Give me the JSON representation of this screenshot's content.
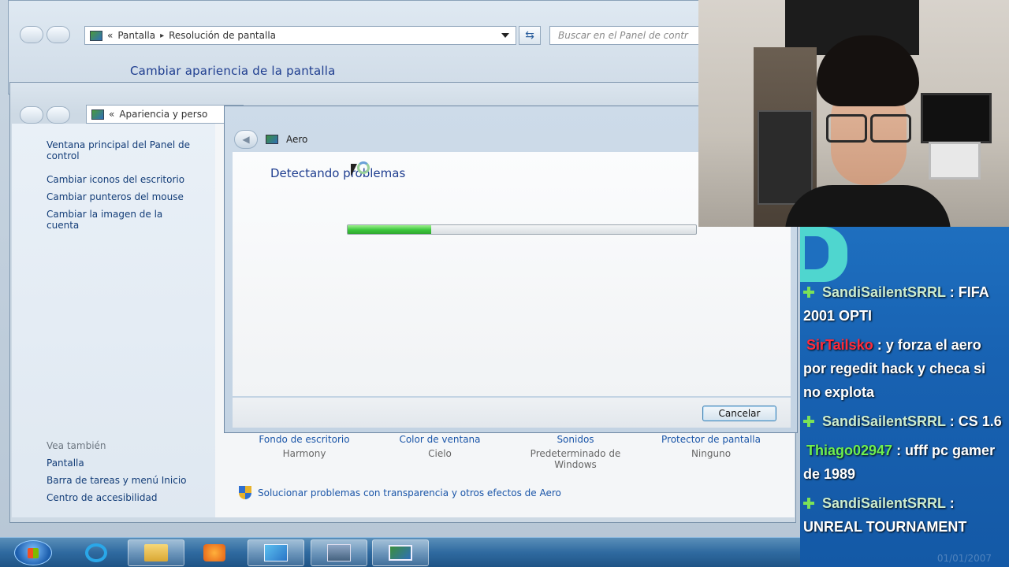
{
  "back_window": {
    "breadcrumb_sep": "«",
    "breadcrumb_1": "Pantalla",
    "breadcrumb_arrow": "▸",
    "breadcrumb_2": "Resolución de pantalla",
    "search_placeholder": "Buscar en el Panel de contr",
    "heading": "Cambiar apariencia de la pantalla"
  },
  "front_window": {
    "breadcrumb_sep": "«",
    "breadcrumb_1": "Apariencia y perso",
    "sidebar": {
      "items": [
        "Ventana principal del Panel de control",
        "Cambiar iconos del escritorio",
        "Cambiar punteros del mouse",
        "Cambiar la imagen de la cuenta"
      ],
      "see_also_label": "Vea también",
      "see_also": [
        "Pantalla",
        "Barra de tareas y menú Inicio",
        "Centro de accesibilidad"
      ]
    },
    "themes": [
      {
        "link": "Fondo de escritorio",
        "value": "Harmony"
      },
      {
        "link": "Color de ventana",
        "value": "Cielo"
      },
      {
        "link": "Sonidos",
        "value": "Predeterminado de Windows"
      },
      {
        "link": "Protector de pantalla",
        "value": "Ninguno"
      }
    ],
    "fix_link": "Solucionar problemas con transparencia y otros efectos de Aero"
  },
  "dialog": {
    "title": "Aero",
    "status": "Detectando problemas",
    "progress": 0.24,
    "cancel_label": "Cancelar"
  },
  "taskbar": {
    "icons": [
      "start-icon",
      "internet-explorer-icon",
      "folder-icon",
      "media-player-icon",
      "control-panel-icon",
      "computer-icon",
      "aero-troubleshooter-icon"
    ]
  },
  "chat": {
    "messages": [
      {
        "user": "SandiSailentSRRL",
        "text": ": FIFA 2001 OPTI",
        "badge": true,
        "color": "green"
      },
      {
        "user": "SirTailsko",
        "text": ": y forza el aero por regedit hack y checa si no explota",
        "badge": false,
        "color": "red"
      },
      {
        "user": "SandiSailentSRRL",
        "text": ": CS 1.6",
        "badge": true,
        "color": "green"
      },
      {
        "user": "Thiago02947",
        "text": ": ufff pc gamer de 1989",
        "badge": false,
        "color": "lime"
      },
      {
        "user": "SandiSailentSRRL",
        "text": ": UNREAL TOURNAMENT",
        "badge": true,
        "color": "green"
      }
    ],
    "watermark": "01/01/2007"
  },
  "colors": {
    "link": "#1a55a8",
    "heading": "#1e3d8f",
    "chat_bg": "#1862b2",
    "progress_fill": "#3bc63b"
  }
}
